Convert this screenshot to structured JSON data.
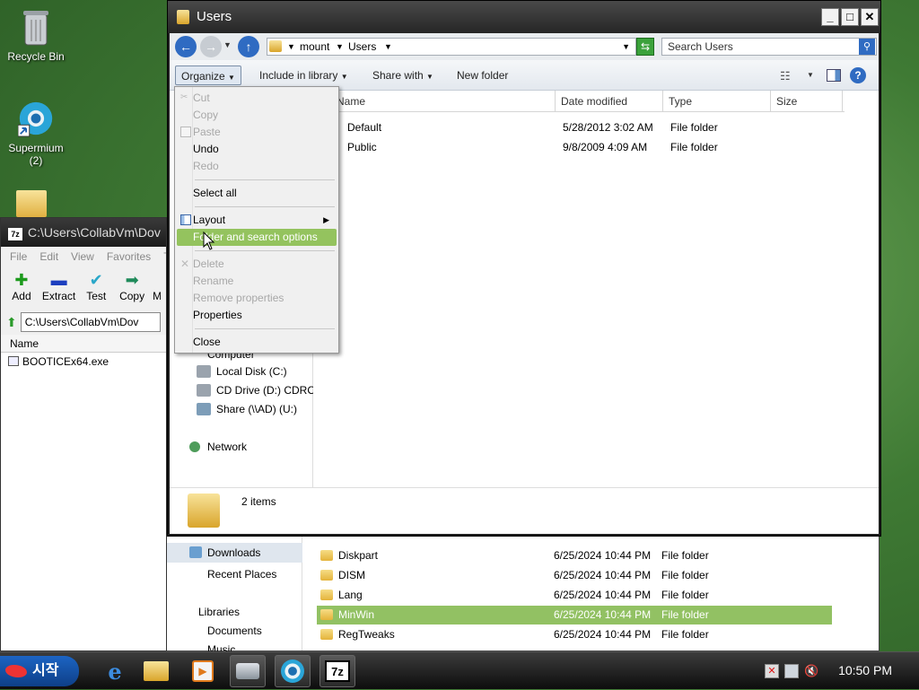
{
  "desktop": {
    "icons": [
      {
        "label": "Recycle Bin"
      },
      {
        "label": "Supermium\n(2)"
      }
    ]
  },
  "back_explorer": {
    "nav": [
      "Downloads",
      "Recent Places",
      "Libraries",
      "Documents",
      "Music"
    ],
    "rows": [
      {
        "name": "Diskpart",
        "date": "6/25/2024 10:44 PM",
        "type": "File folder"
      },
      {
        "name": "DISM",
        "date": "6/25/2024 10:44 PM",
        "type": "File folder"
      },
      {
        "name": "Lang",
        "date": "6/25/2024 10:44 PM",
        "type": "File folder"
      },
      {
        "name": "MinWin",
        "date": "6/25/2024 10:44 PM",
        "type": "File folder",
        "selected": true
      },
      {
        "name": "RegTweaks",
        "date": "6/25/2024 10:44 PM",
        "type": "File folder"
      }
    ]
  },
  "sevenzip": {
    "title": "C:\\Users\\CollabVm\\Dov",
    "menu": [
      "File",
      "Edit",
      "View",
      "Favorites",
      "T"
    ],
    "tools": [
      "Add",
      "Extract",
      "Test",
      "Copy",
      "M"
    ],
    "address": "C:\\Users\\CollabVm\\Dov",
    "col_name": "Name",
    "file": "BOOTICEx64.exe"
  },
  "explorer": {
    "title": "Users",
    "breadcrumb": [
      "mount",
      "Users"
    ],
    "search_placeholder": "Search Users",
    "commands": {
      "organize": "Organize",
      "include": "Include in library",
      "share": "Share with",
      "new_folder": "New folder"
    },
    "columns": {
      "name": "Name",
      "date": "Date modified",
      "type": "Type",
      "size": "Size"
    },
    "rows": [
      {
        "name": "Default",
        "date": "5/28/2012 3:02 AM",
        "type": "File folder"
      },
      {
        "name": "Public",
        "date": "9/8/2009 4:09 AM",
        "type": "File folder"
      }
    ],
    "nav": {
      "computer": "Computer",
      "local_disk": "Local Disk (C:)",
      "cd": "CD Drive (D:) CDROM",
      "share": "Share (\\\\AD) (U:)",
      "network": "Network"
    },
    "status": "2 items"
  },
  "organize_menu": {
    "cut": "Cut",
    "copy": "Copy",
    "paste": "Paste",
    "undo": "Undo",
    "redo": "Redo",
    "select_all": "Select all",
    "layout": "Layout",
    "folder_options": "Folder and search options",
    "delete": "Delete",
    "rename": "Rename",
    "remove_props": "Remove properties",
    "properties": "Properties",
    "close": "Close"
  },
  "taskbar": {
    "start": "시작",
    "clock": "10:50 PM"
  },
  "colors": {
    "accent_green": "#94c35e",
    "selection": "#92c163"
  }
}
